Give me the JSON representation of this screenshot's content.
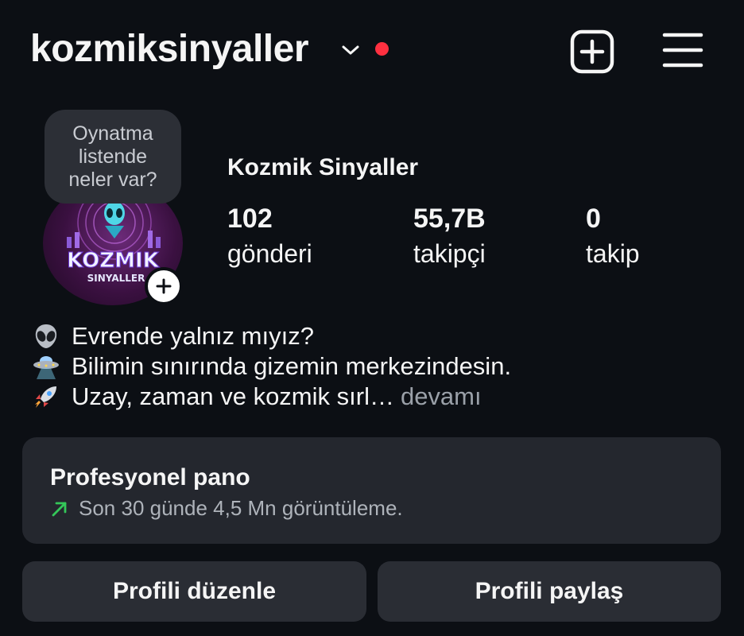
{
  "header": {
    "username": "kozmiksinyaller",
    "icons": {
      "switch": "chevron-down-icon",
      "notification": "red-dot",
      "create": "plus-square-icon",
      "menu": "hamburger-icon"
    },
    "notification_color": "#ff3040"
  },
  "note": {
    "lines": [
      "Oynatma",
      "listende",
      "neler var?"
    ]
  },
  "avatar": {
    "logo_text": "KOZMIK",
    "logo_subtext": "SINYALLER"
  },
  "profile": {
    "display_name": "Kozmik Sinyaller",
    "stats": [
      {
        "value": "102",
        "label": "gönderi"
      },
      {
        "value": "55,7B",
        "label": "takipçi"
      },
      {
        "value": "0",
        "label": "takip"
      }
    ]
  },
  "bio": {
    "lines": [
      {
        "emoji": "alien-icon",
        "text": "Evrende yalnız mıyız?"
      },
      {
        "emoji": "ufo-icon",
        "text": "Bilimin sınırında gizemin merkezindesin."
      },
      {
        "emoji": "rocket-icon",
        "text": "Uzay, zaman ve kozmik sırl…"
      }
    ],
    "more_label": "devamı"
  },
  "professional": {
    "title": "Profesyonel pano",
    "subtitle": "Son 30 günde 4,5 Mn görüntüleme.",
    "trend_color": "#34c759"
  },
  "buttons": {
    "edit": "Profili düzenle",
    "share": "Profili paylaş"
  }
}
